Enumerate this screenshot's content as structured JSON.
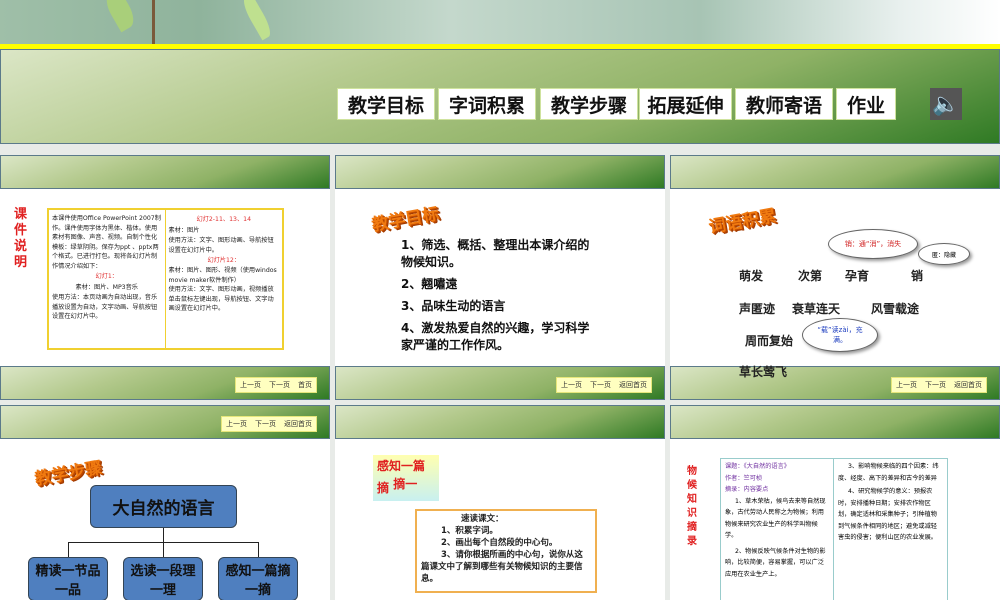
{
  "top_slide": {
    "nav": [
      "教学目标",
      "字词积累",
      "教学步骤",
      "拓展延伸",
      "教师寄语",
      "作业"
    ],
    "speaker_icon": "speaker-icon"
  },
  "nav_small": {
    "prev": "上一页",
    "next": "下一页",
    "home": "首页",
    "back_home": "返回首页"
  },
  "slide_notes": {
    "title": "课件说明",
    "left": [
      "本课件使用Office PowerPoint 2007制作。课件使用字体为黑体、楷体。使用素材有图像、声音、视频。自制个性化模板：绿草阴阴。保存为ppt 、pptx两个格式。已进行打包。现将各幻灯片制作情况介绍如下：",
      "幻灯1：",
      "素材：图片、MP3音乐",
      "使用方法：本页动画为自动出现，音乐播放设置为自动，文字动画、导航按钮设置在幻灯片中。"
    ],
    "right": [
      "幻灯2-11、13、14",
      "素材：图片",
      "使用方法：文字、图形动画、导航按钮设置在幻灯片中。",
      "幻灯片12：",
      "素材：图片、图形、视频（使用windos movie maker软件制作）",
      "使用方法：文字、图形动画，视频播放单击鼠标左键出现，导航按钮、文字动画设置在幻灯片中。"
    ]
  },
  "slide_goals": {
    "title": "教学目标",
    "items": [
      "1、筛选、概括、整理出本课介绍的物候知识。",
      "2、翹嘯遠",
      "3、品味生动的语言",
      "4、激发热爱自然的兴趣，学习科学家严谨的工作作风。"
    ]
  },
  "slide_words": {
    "title": "词语积累",
    "words": [
      "萌发",
      "次第",
      "孕育",
      "销",
      "声匿迹",
      "衰草连天",
      "风雪载途",
      "周而复始",
      "草长莺飞"
    ],
    "bubbles": [
      "销：通“消”，消失",
      "匿：隐藏",
      "“载”读zài，充满。"
    ]
  },
  "slide_steps": {
    "title": "教学步骤",
    "root": "大自然的语言",
    "children": [
      "精读一节品一品",
      "选读一段理一理",
      "感知一篇摘一摘"
    ]
  },
  "slide_perceive": {
    "title_line1": "感知一篇",
    "title_line2a": "摘",
    "title_line2b": "摘一",
    "box": [
      "速读课文：",
      "1、积累字词。",
      "2、画出每个自然段的中心句。",
      "3、请你根据所画的中心句，说你从这篇课文中了解到哪些有关物候知识的主要信息。"
    ]
  },
  "slide_excerpt": {
    "title": "物候知识摘录",
    "left_meta": [
      "课题：《大自然的语言》",
      "作者：竺可桢",
      "摘录：内容要点"
    ],
    "left": [
      "1、草木荣枯，候鸟去来等自然现象，古代劳动人民称之为物候；利用物候来研究农业生产的科学叫物候学。",
      "2、物候反映气候条件对生物的影响，比较简便，容易掌握，可以广泛应用在农业生产上。"
    ],
    "right": [
      "3、影响物候来临的四个因素：纬度、经度、高下的差异和古今的差异",
      "4、研究物候学的意义：预报农时，安排播种日期；安排农作物区划，确定适林和采集种子；引种植物到气候条件相同的地区；避免或减轻害虫的侵害；便利山区的农业发展。"
    ]
  }
}
